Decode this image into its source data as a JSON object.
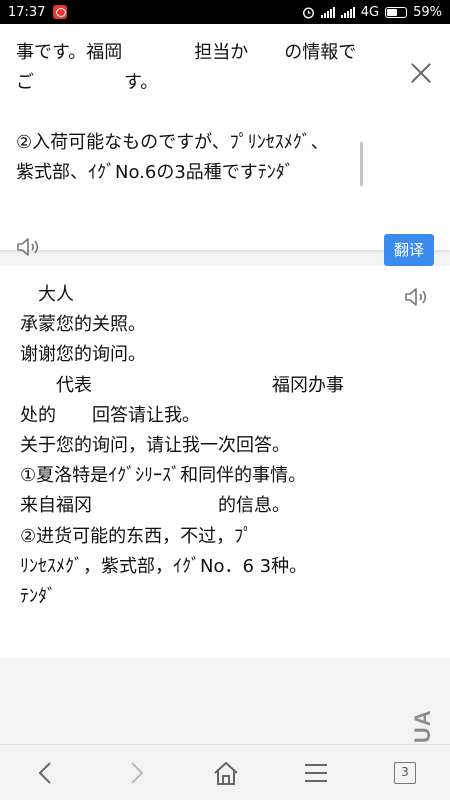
{
  "status_bar": {
    "time": "17:37",
    "network": "4G",
    "battery": "59%",
    "battery_level": 0.59
  },
  "source": {
    "lines": [
      "事です。福岡　　　　担当か　　の情報で",
      "ご　　　　　す。",
      "",
      "②入荷可能なものですが、ﾌﾟﾘﾝｾｽﾒｸﾞ、",
      "紫式部、ｲｸﾞNo.6の3品種ですﾃﾝﾀﾞ"
    ],
    "close_icon": "close-icon",
    "speaker_icon": "speaker-icon"
  },
  "translate_button": {
    "label": "翻译",
    "color": "#3c8cf0"
  },
  "result": {
    "lines": [
      "　大人",
      "承蒙您的关照。",
      "谢谢您的询问。",
      "　　代表　　　　　　　　　　福冈办事",
      "处的　　回答请让我。",
      "关于您的询问，请让我一次回答。",
      "①夏洛特是ｲｸﾞｼﾘｰｽﾞ和同伴的事情。",
      "来自福冈　　　　　　　的信息。",
      "②进货可能的东西，不过，ﾌﾟ",
      "ﾘﾝｾｽﾒｸﾞ，紫式部，ｲｸﾞNo．6 3种。",
      "ﾃﾝﾀﾞ"
    ],
    "speaker_icon": "speaker-icon"
  },
  "watermark": "MSHUA",
  "bottom_nav": {
    "items": [
      "back-icon",
      "forward-icon",
      "home-icon",
      "menu-icon",
      "tabs-icon"
    ],
    "tab_count": "3"
  }
}
